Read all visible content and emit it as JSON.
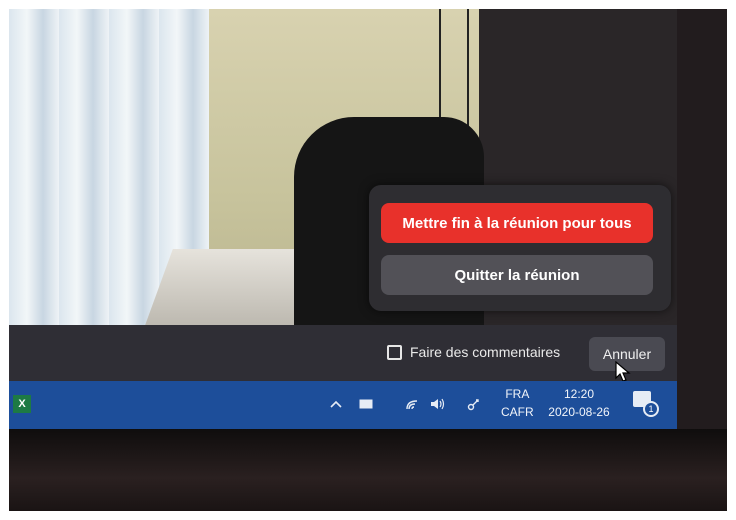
{
  "popup": {
    "end_for_all_label": "Mettre fin à la réunion pour tous",
    "leave_label": "Quitter la réunion"
  },
  "bottom_bar": {
    "feedback_label": "Faire des commentaires",
    "feedback_checked": false,
    "cancel_label": "Annuler"
  },
  "taskbar": {
    "app_icon_text": "X",
    "tray_icons": [
      "chevron-up-icon",
      "message-icon",
      "wifi-icon",
      "volume-icon",
      "network-icon"
    ],
    "lang_line1": "FRA",
    "lang_line2": "CAFR",
    "time": "12:20",
    "date": "2020-08-26",
    "notification_count": "1"
  },
  "colors": {
    "end_button": "#e8312b",
    "taskbar": "#1d4e9a",
    "popup_bg": "#2e2d31"
  }
}
